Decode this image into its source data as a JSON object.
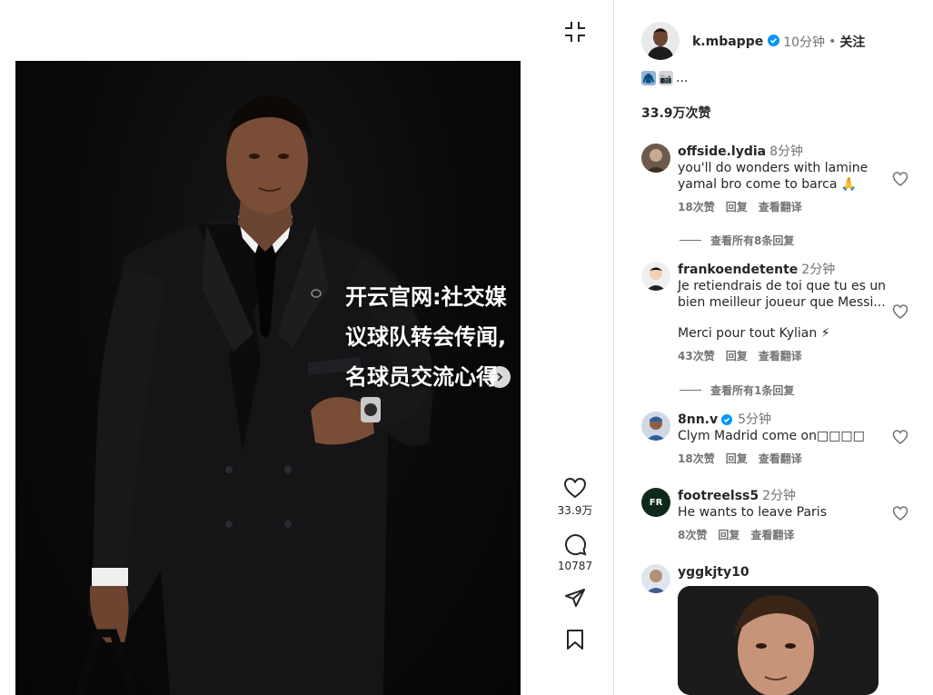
{
  "post": {
    "overlay_lines": [
      "开云官网:社交媒",
      "议球队转会传闻,",
      "名球员交流心得"
    ],
    "likes_count": "33.9万",
    "comments_count": "10787"
  },
  "header": {
    "username": "k.mbappe",
    "time": "10分钟",
    "dot": "•",
    "follow_label": "关注"
  },
  "caption": {
    "emojis": [
      "🧥",
      "📷"
    ],
    "ellipsis": "..."
  },
  "likes_total": "33.9万次赞",
  "comments": [
    {
      "user": "offside.lydia",
      "time": "8分钟",
      "text": "you'll do wonders with lamine yamal bro come to barca 🙏",
      "likes": "18次赞",
      "reply": "回复",
      "translate": "查看翻译",
      "view_replies": "查看所有8条回复"
    },
    {
      "user": "frankoendetente",
      "time": "2分钟",
      "text": "Je retiendrais de toi que tu es un bien meilleur joueur que Messi...",
      "extra_text": "Merci pour tout Kylian ⚡",
      "likes": "43次赞",
      "reply": "回复",
      "translate": "查看翻译",
      "view_replies": "查看所有1条回复"
    },
    {
      "user": "8nn.v",
      "time": "5分钟",
      "text": "Clym Madrid come on□□□□",
      "likes": "18次赞",
      "reply": "回复",
      "translate": "查看翻译"
    },
    {
      "user": "footreelss5",
      "time": "2分钟",
      "text": "He wants to leave Paris",
      "likes": "8次赞",
      "reply": "回复",
      "translate": "查看翻译"
    },
    {
      "user": "yggkjty10"
    }
  ],
  "colors": {
    "accent_verified": "#0095f6",
    "text": "#262626",
    "muted": "#737373"
  },
  "icons": {
    "collapse": "collapse-icon",
    "heart": "heart-icon",
    "comment": "comment-icon",
    "share": "share-icon",
    "bookmark": "bookmark-icon",
    "next": "chevron-right-icon"
  }
}
